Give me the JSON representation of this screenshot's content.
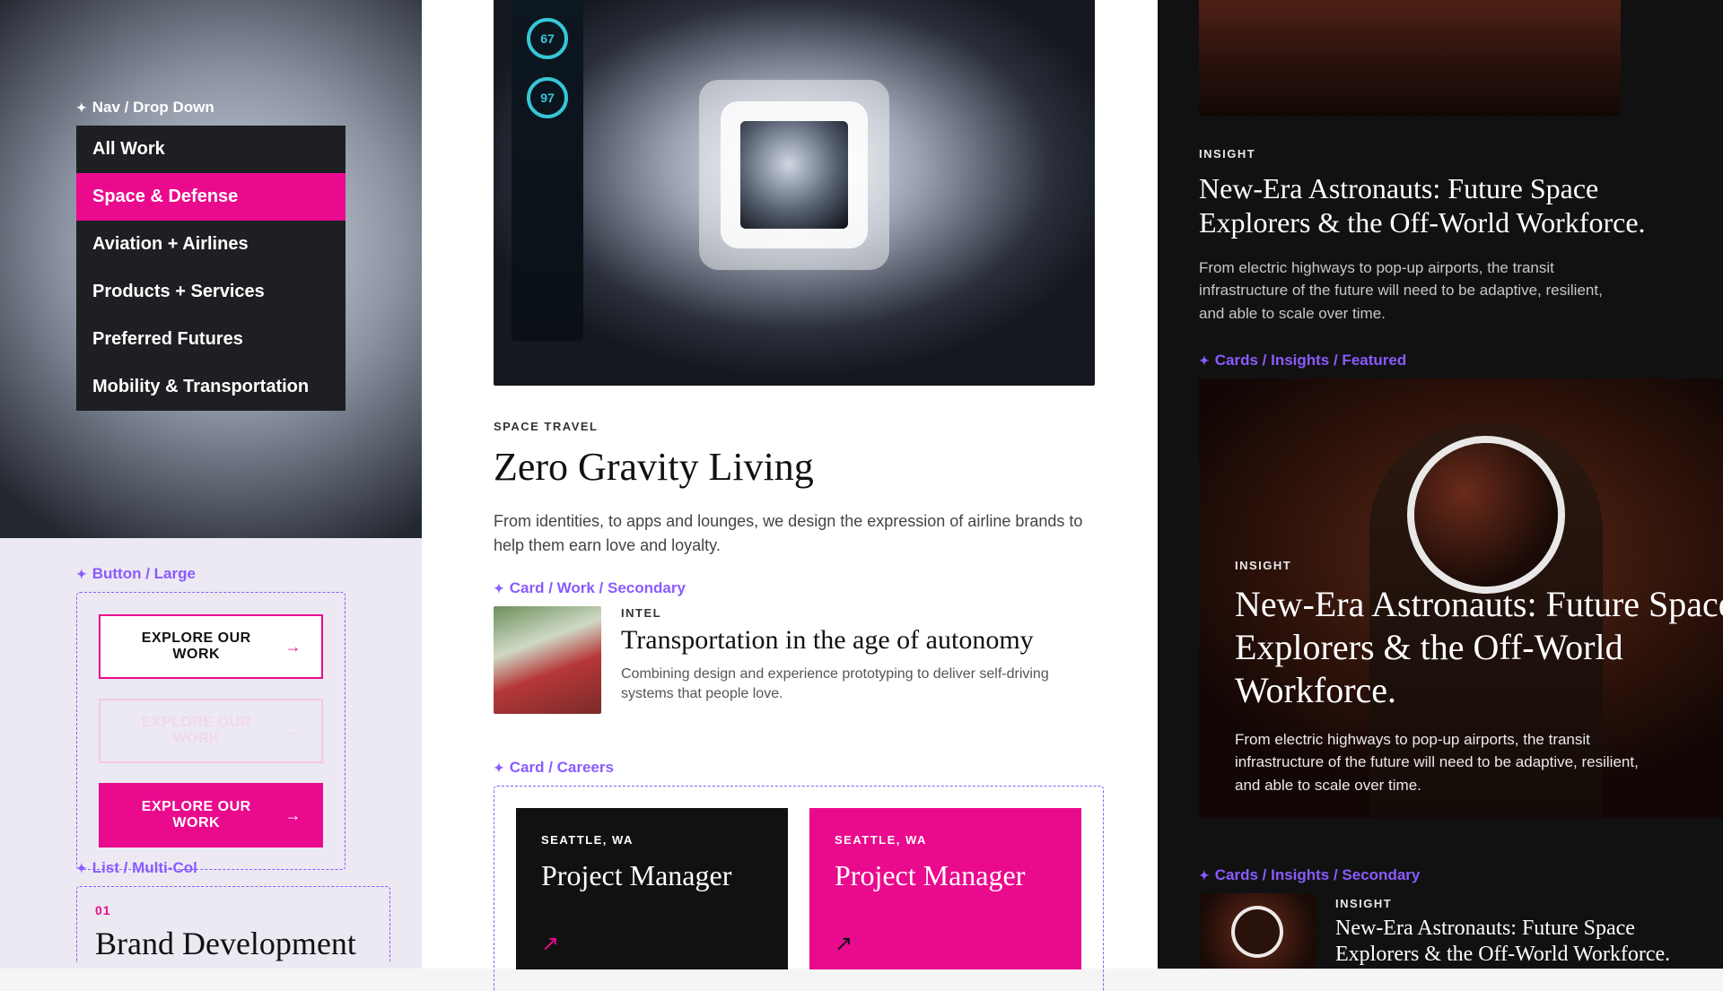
{
  "left": {
    "nav": {
      "componentLabel": "Nav / Drop Down",
      "items": [
        {
          "label": "All Work"
        },
        {
          "label": "Space & Defense"
        },
        {
          "label": "Aviation + Airlines"
        },
        {
          "label": "Products + Services"
        },
        {
          "label": "Preferred Futures"
        },
        {
          "label": "Mobility & Transportation"
        }
      ],
      "activeIndex": 1
    },
    "buttons": {
      "componentLabel": "Button / Large",
      "label": "EXPLORE OUR WORK"
    },
    "list": {
      "componentLabel": "List / Multi-Col",
      "number": "01",
      "title": "Brand Development"
    }
  },
  "mid": {
    "hero": {
      "gauges": [
        "67",
        "97"
      ],
      "kicker": "SPACE TRAVEL",
      "title": "Zero Gravity Living",
      "body": "From identities, to apps and lounges, we design the expression of airline brands to help them earn love and loyalty."
    },
    "secondary": {
      "componentLabel": "Card / Work / Secondary",
      "kicker": "INTEL",
      "title": "Transportation in the age of autonomy",
      "body": "Combining design and experience prototyping to deliver self-driving systems that people love."
    },
    "careers": {
      "componentLabel": "Card / Careers",
      "cards": [
        {
          "location": "SEATTLE, WA",
          "title": "Project Manager"
        },
        {
          "location": "SEATTLE, WA",
          "title": "Project Manager"
        }
      ]
    }
  },
  "right": {
    "insight": {
      "kicker": "INSIGHT",
      "title": "New-Era Astronauts: Future Space Explorers & the Off-World Workforce.",
      "body": "From electric highways to pop-up airports, the transit infrastructure of the future will need to be adaptive, resilient, and able to scale over time."
    },
    "featured": {
      "componentLabel": "Cards / Insights / Featured",
      "kicker": "INSIGHT",
      "title": "New-Era Astronauts: Future Space Explorers & the Off-World Workforce.",
      "body": "From electric highways to pop-up airports, the transit infrastructure of the future will need to be adaptive, resilient, and able to scale over time."
    },
    "secondary": {
      "componentLabel": "Cards / Insights / Secondary",
      "kicker": "INSIGHT",
      "title": "New-Era Astronauts: Future Space Explorers & the Off-World Workforce."
    }
  }
}
